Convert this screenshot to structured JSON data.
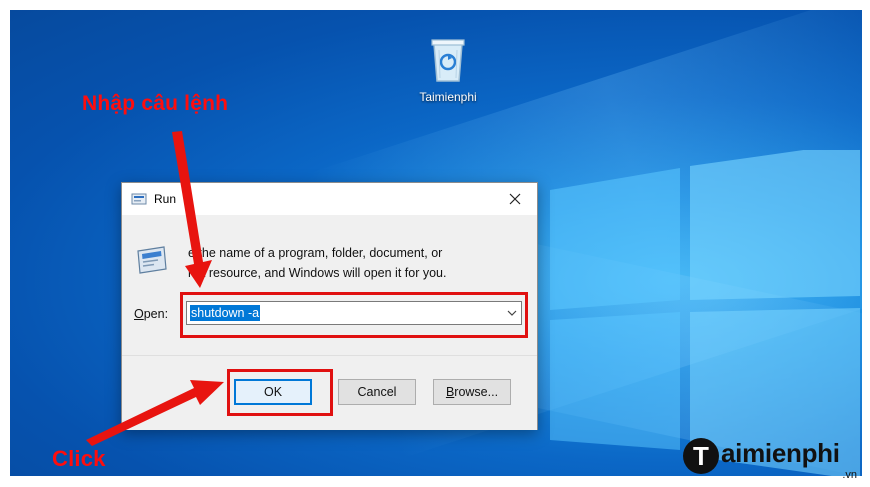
{
  "desktop": {
    "recycle_bin_label": "Taimienphi",
    "icon": "recycle-bin-icon"
  },
  "annotations": {
    "instruction": "Nhập câu lệnh",
    "click": "Click",
    "highlight_color": "#e01010"
  },
  "run_dialog": {
    "title": "Run",
    "title_icon": "run-icon",
    "close_icon": "close-icon",
    "description_line1": "e the name of a program, folder, document, or",
    "description_line2": "net resource, and Windows will open it for you.",
    "open_label_underlined": "O",
    "open_label_rest": "pen:",
    "open_value": "shutdown -a",
    "buttons": {
      "ok": "OK",
      "cancel": "Cancel",
      "browse_underlined": "B",
      "browse_rest": "rowse..."
    }
  },
  "watermark": {
    "logo_letter": "T",
    "brand_text": "aimienphi",
    "suffix": ".vn"
  },
  "colors": {
    "accent": "#0078d7",
    "desktop_blue": "#0b67c6",
    "annotation_red": "#ff0d0d"
  }
}
